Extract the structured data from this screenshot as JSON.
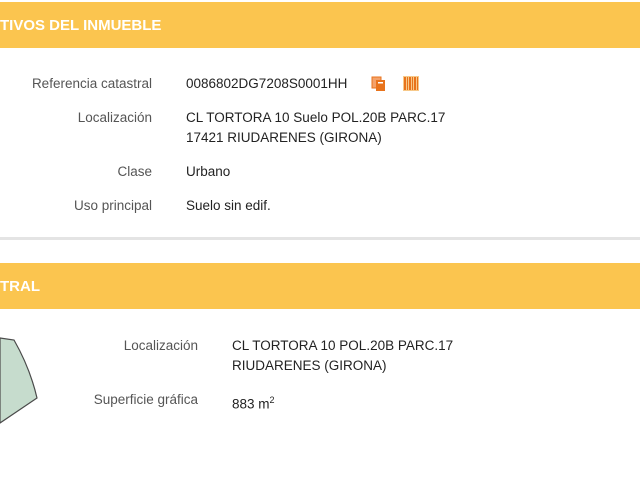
{
  "panel1": {
    "title": "TIVOS DEL INMUEBLE",
    "fields": [
      {
        "label": "Referencia catastral",
        "value": "0086802DG7208S0001HH"
      },
      {
        "label": "Localización",
        "value": "CL TORTORA 10 Suelo POL.20B PARC.17",
        "value2": "17421 RIUDARENES (GIRONA)"
      },
      {
        "label": "Clase",
        "value": "Urbano"
      },
      {
        "label": "Uso principal",
        "value": "Suelo sin edif."
      }
    ],
    "icons": [
      "copy-icon",
      "barcode-icon"
    ]
  },
  "panel2": {
    "title": "TRAL",
    "fields": [
      {
        "label": "Localización",
        "value": "CL TORTORA 10 POL.20B PARC.17",
        "value2": "RIUDARENES (GIRONA)"
      },
      {
        "label": "Superficie gráfica",
        "value": "883 m",
        "unit_sup": "2"
      }
    ]
  },
  "colors": {
    "band": "#fbc54f",
    "map_fill": "#c6dccd",
    "icon_orange": "#e8731c"
  }
}
